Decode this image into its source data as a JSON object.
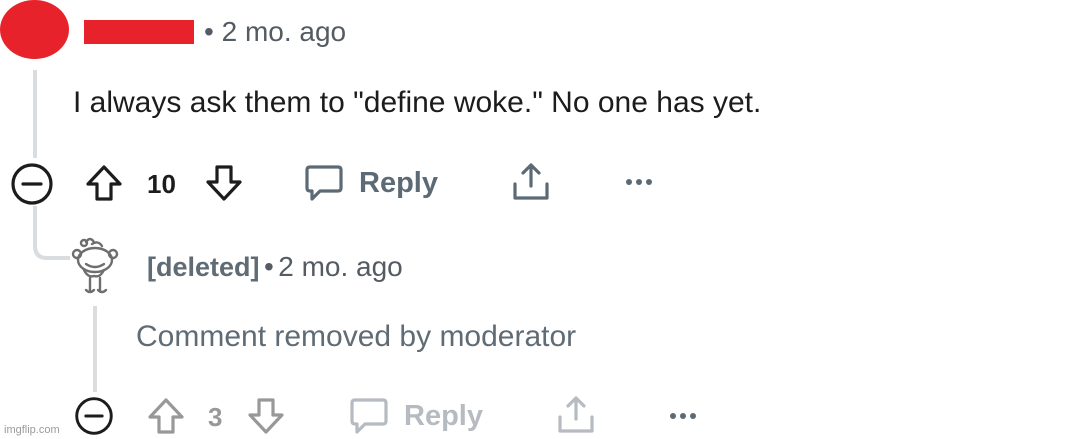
{
  "comment": {
    "separator": "•",
    "timestamp": "2 mo. ago",
    "body": "I always ask them to \"define woke.\" No one has yet.",
    "actions": {
      "vote_count": "10",
      "reply_label": "Reply"
    }
  },
  "reply": {
    "author": "[deleted]",
    "separator": "•",
    "timestamp": "2 mo. ago",
    "body": "Comment removed by moderator",
    "actions": {
      "vote_count": "3",
      "reply_label": "Reply"
    }
  },
  "watermark": "imgflip.com",
  "colors": {
    "redacted": "#e8222b",
    "text": "#1c1c1c",
    "muted": "#5f6b75",
    "thread_line": "#dadde0"
  },
  "icons": [
    "collapse-icon",
    "upvote-icon",
    "downvote-icon",
    "comment-bubble-icon",
    "share-icon",
    "more-options-icon",
    "snoo-avatar-icon"
  ]
}
